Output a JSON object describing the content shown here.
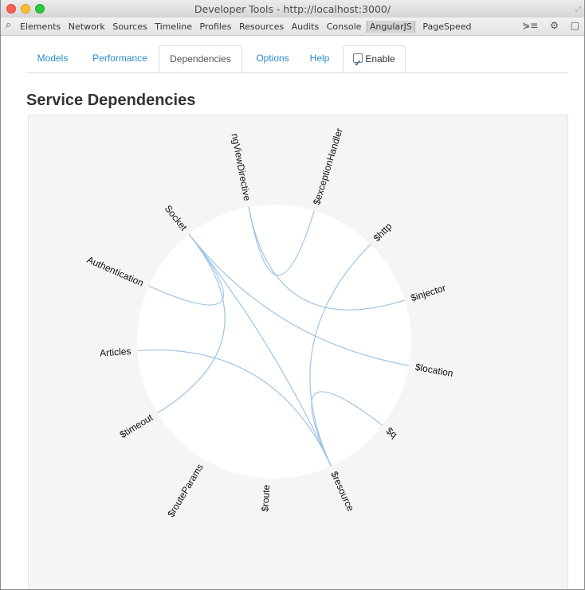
{
  "window": {
    "title": "Developer Tools - http://localhost:3000/",
    "resize_icon": "resize-icon"
  },
  "toolbar": {
    "search_icon": "search-icon",
    "tabs": [
      "Elements",
      "Network",
      "Sources",
      "Timeline",
      "Profiles",
      "Resources",
      "Audits",
      "Console",
      "AngularJS",
      "PageSpeed"
    ],
    "active_tab": "AngularJS",
    "icons": [
      "console-drawer-icon",
      "gear-icon",
      "dock-icon"
    ]
  },
  "batarang": {
    "tabs": [
      "Models",
      "Performance",
      "Dependencies",
      "Options",
      "Help"
    ],
    "active_tab": "Dependencies",
    "enable_label": "Enable",
    "enable_checked": true,
    "heading": "Service Dependencies"
  },
  "graph": {
    "nodes": [
      "$exceptionHandler",
      "$http",
      "$injector",
      "$location",
      "$q",
      "$resource",
      "$route",
      "$routeParams",
      "$timeout",
      "Articles",
      "Authentication",
      "Socket",
      "ngViewDirective"
    ],
    "edges": [
      [
        "ngViewDirective",
        "$exceptionHandler"
      ],
      [
        "ngViewDirective",
        "$injector"
      ],
      [
        "Socket",
        "$resource"
      ],
      [
        "Socket",
        "$location"
      ],
      [
        "Authentication",
        "Socket"
      ],
      [
        "Articles",
        "$resource"
      ],
      [
        "$timeout",
        "Socket"
      ],
      [
        "$http",
        "$resource"
      ],
      [
        "$q",
        "$resource"
      ]
    ],
    "colors": {
      "link": "#9ec4e6",
      "circle": "#ffffff",
      "panel": "#f5f5f5"
    }
  }
}
